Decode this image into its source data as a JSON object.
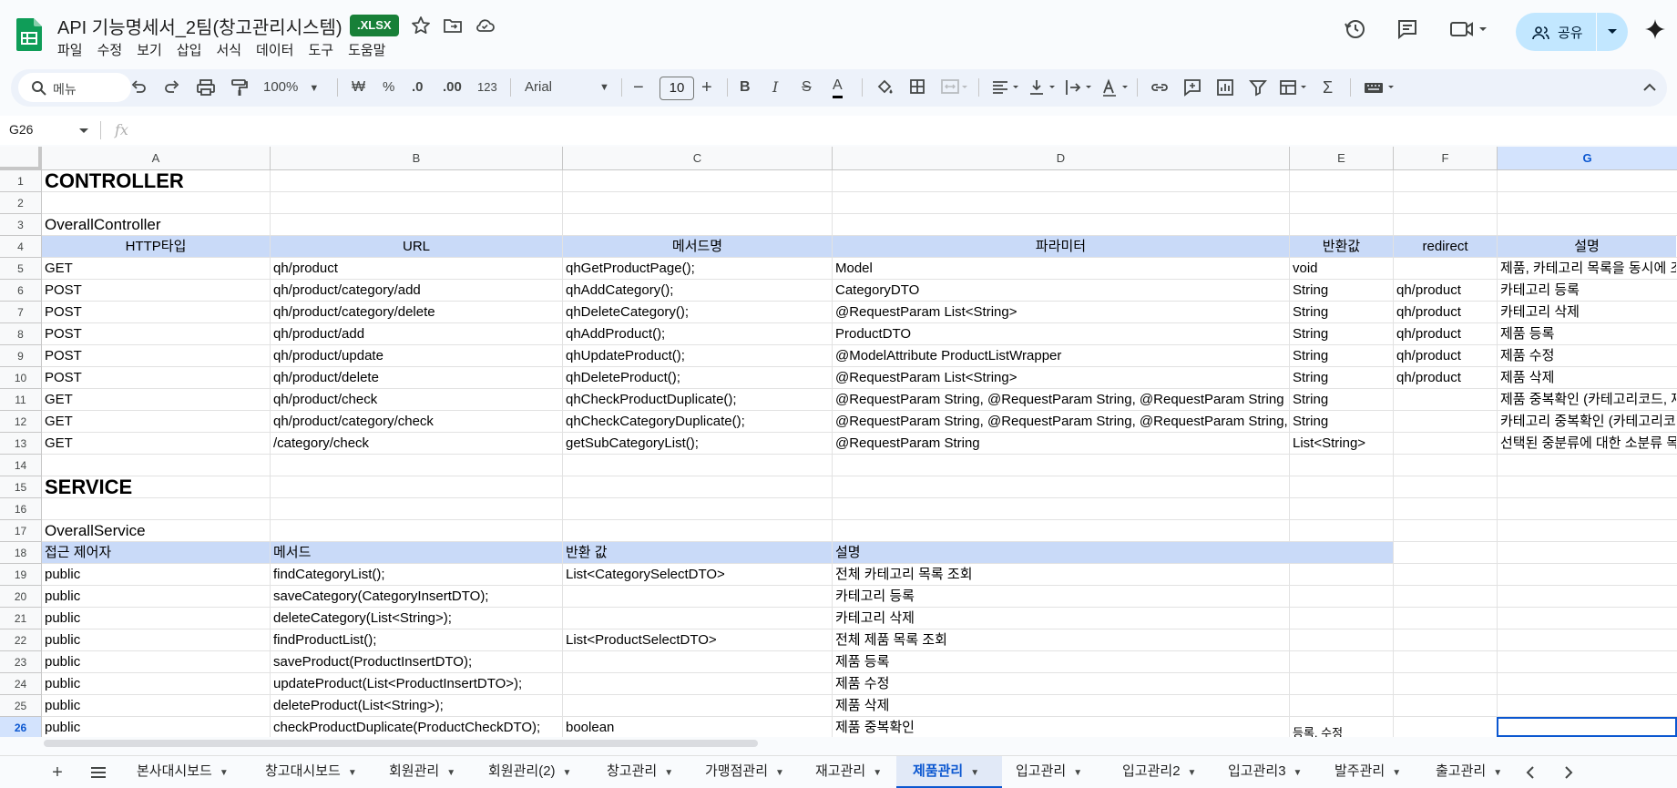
{
  "app": {
    "doc_title": "API 기능명세서_2팀(창고관리시스템)",
    "file_badge": ".XLSX",
    "share_label": "공유",
    "accent_color": "#0b57d0",
    "header_fill_color": "#c9daf8"
  },
  "menu": [
    "파일",
    "수정",
    "보기",
    "삽입",
    "서식",
    "데이터",
    "도구",
    "도움말"
  ],
  "toolbar": {
    "search_label": "메뉴",
    "zoom": "100%",
    "currency": "₩",
    "percent": "%",
    "decrease_decimal": ".0",
    "increase_decimal": ".00",
    "number_format": "123",
    "font": "Arial",
    "font_size": "10",
    "bold": "B",
    "italic": "I",
    "text_color": "A"
  },
  "formula_bar": {
    "name_box": "G26",
    "fx": "fx",
    "value": ""
  },
  "columns": [
    {
      "letter": "A"
    },
    {
      "letter": "B"
    },
    {
      "letter": "C"
    },
    {
      "letter": "D"
    },
    {
      "letter": "E"
    },
    {
      "letter": "F"
    },
    {
      "letter": "G"
    }
  ],
  "rows": [
    "1",
    "2",
    "3",
    "4",
    "5",
    "6",
    "7",
    "8",
    "9",
    "10",
    "11",
    "12",
    "13",
    "14",
    "15",
    "16",
    "17",
    "18",
    "19",
    "20",
    "21",
    "22",
    "23",
    "24",
    "25",
    "26"
  ],
  "sheet": {
    "controller_title": "CONTROLLER",
    "controller_class": "OverallController",
    "controller_headers": [
      "HTTP타입",
      "URL",
      "메서드명",
      "파라미터",
      "반환값",
      "redirect",
      "설명"
    ],
    "controller_rows": [
      [
        "GET",
        "qh/product",
        "qhGetProductPage();",
        "Model",
        "void",
        "",
        "제품, 카테고리 목록을 동시에 조"
      ],
      [
        "POST",
        "qh/product/category/add",
        "qhAddCategory();",
        "CategoryDTO",
        "String",
        "qh/product",
        "카테고리 등록"
      ],
      [
        "POST",
        "qh/product/category/delete",
        "qhDeleteCategory();",
        "@RequestParam List<String>",
        "String",
        "qh/product",
        "카테고리 삭제"
      ],
      [
        "POST",
        "qh/product/add",
        "qhAddProduct();",
        "ProductDTO",
        "String",
        "qh/product",
        "제품 등록"
      ],
      [
        "POST",
        "qh/product/update",
        "qhUpdateProduct();",
        "@ModelAttribute ProductListWrapper",
        "String",
        "qh/product",
        "제품 수정"
      ],
      [
        "POST",
        "qh/product/delete",
        "qhDeleteProduct();",
        "@RequestParam List<String>",
        "String",
        "qh/product",
        "제품 삭제"
      ],
      [
        "GET",
        "qh/product/check",
        "qhCheckProductDuplicate();",
        "@RequestParam String, @RequestParam String, @RequestParam String",
        "String",
        "",
        "제품 중복확인 (카테고리코드, 제"
      ],
      [
        "GET",
        "qh/product/category/check",
        "qhCheckCategoryDuplicate();",
        "@RequestParam String, @RequestParam String, @RequestParam String,",
        "String",
        "",
        "카테고리 중복확인 (카테고리코드"
      ],
      [
        "GET",
        "/category/check",
        "getSubCategoryList();",
        "@RequestParam String",
        "List<String>",
        "",
        "선택된 중분류에 대한 소분류 목"
      ]
    ],
    "service_title": "SERVICE",
    "service_class": "OverallService",
    "service_headers": [
      "접근 제어자",
      "메서드",
      "반환 값",
      "설명"
    ],
    "service_rows": [
      [
        "public",
        "findCategoryList();",
        "List<CategorySelectDTO>",
        "전체 카테고리 목록 조회"
      ],
      [
        "public",
        "saveCategory(CategoryInsertDTO);",
        "",
        "카테고리 등록"
      ],
      [
        "public",
        "deleteCategory(List<String>);",
        "",
        "카테고리 삭제"
      ],
      [
        "public",
        "findProductList();",
        "List<ProductSelectDTO>",
        "전체 제품 목록 조회"
      ],
      [
        "public",
        "saveProduct(ProductInsertDTO);",
        "",
        "제품 등록"
      ],
      [
        "public",
        "updateProduct(List<ProductInsertDTO>);",
        "",
        "제품 수정"
      ],
      [
        "public",
        "deleteProduct(List<String>);",
        "",
        "제품 삭제"
      ],
      [
        "public",
        "checkProductDuplicate(ProductCheckDTO);",
        "boolean",
        "제품 중복확인"
      ]
    ],
    "row26_extra": "등록, 수정"
  },
  "tabs": [
    {
      "label": "본사대시보드"
    },
    {
      "label": "창고대시보드"
    },
    {
      "label": "회원관리"
    },
    {
      "label": "회원관리(2)"
    },
    {
      "label": "창고관리"
    },
    {
      "label": "가맹점관리"
    },
    {
      "label": "재고관리"
    },
    {
      "label": "제품관리",
      "active": true
    },
    {
      "label": "입고관리"
    },
    {
      "label": "입고관리2"
    },
    {
      "label": "입고관리3"
    },
    {
      "label": "발주관리"
    },
    {
      "label": "출고관리"
    }
  ]
}
